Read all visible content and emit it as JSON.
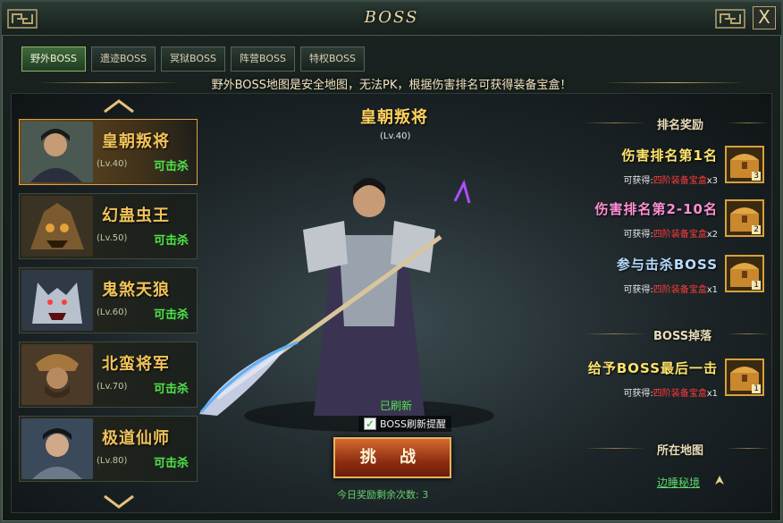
{
  "window": {
    "title": "BOSS",
    "close_label": "X"
  },
  "tabs": [
    {
      "label": "野外BOSS",
      "active": true
    },
    {
      "label": "遗迹BOSS",
      "active": false
    },
    {
      "label": "冥狱BOSS",
      "active": false
    },
    {
      "label": "阵营BOSS",
      "active": false
    },
    {
      "label": "特权BOSS",
      "active": false
    }
  ],
  "notice": "野外BOSS地图是安全地图，无法PK，根据伤害排名可获得装备宝盒！",
  "boss_list": [
    {
      "name": "皇朝叛将",
      "level": "(Lv.40)",
      "status": "可击杀"
    },
    {
      "name": "幻蛊虫王",
      "level": "(Lv.50)",
      "status": "可击杀"
    },
    {
      "name": "鬼煞天狼",
      "level": "(Lv.60)",
      "status": "可击杀"
    },
    {
      "name": "北蛮将军",
      "level": "(Lv.70)",
      "status": "可击杀"
    },
    {
      "name": "极道仙师",
      "level": "(Lv.80)",
      "status": "可击杀"
    }
  ],
  "selected": {
    "name": "皇朝叛将",
    "level": "(Lv.40)",
    "refresh_status": "已刷新",
    "remind_label": "BOSS刷新提醒",
    "remind_checked": true,
    "challenge_label": "挑 战",
    "remaining_text": "今日奖励剩余次数: 3"
  },
  "rewards": {
    "rank_title": "排名奖励",
    "items": [
      {
        "title": "伤害排名第1名",
        "prefix": "可获得:",
        "item": "四阶装备宝盒",
        "count": "x3",
        "chest_count": "3"
      },
      {
        "title": "伤害排名第2-10名",
        "prefix": "可获得:",
        "item": "四阶装备宝盒",
        "count": "x2",
        "chest_count": "2"
      },
      {
        "title": "参与击杀BOSS",
        "prefix": "可获得:",
        "item": "四阶装备宝盒",
        "count": "x1",
        "chest_count": "1"
      }
    ],
    "drop_title": "BOSS掉落",
    "drop": {
      "title": "给予BOSS最后一击",
      "prefix": "可获得:",
      "item": "四阶装备宝盒",
      "count": "x1",
      "chest_count": "1"
    },
    "map_title": "所在地图",
    "map_name": "边睡秘境"
  },
  "colors": {
    "accent_gold": "#f1c35a",
    "status_green": "#4fe34a",
    "reward_red": "#ff3b3b"
  }
}
